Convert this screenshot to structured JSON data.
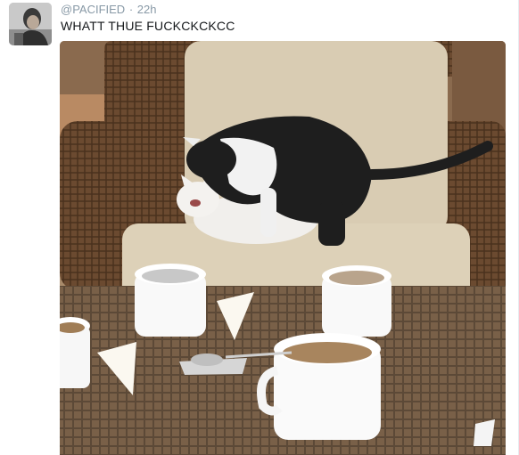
{
  "author": {
    "handle": "@PACIFIED",
    "time": "22h",
    "separator": "·"
  },
  "tweet": {
    "text": "WHATT THUE FUCKCKCKCC"
  },
  "icons": {
    "avatar": "profile-photo",
    "media": "photo-cats-on-chair"
  },
  "colors": {
    "meta_text": "#8899a6",
    "body_text": "#14171a"
  }
}
